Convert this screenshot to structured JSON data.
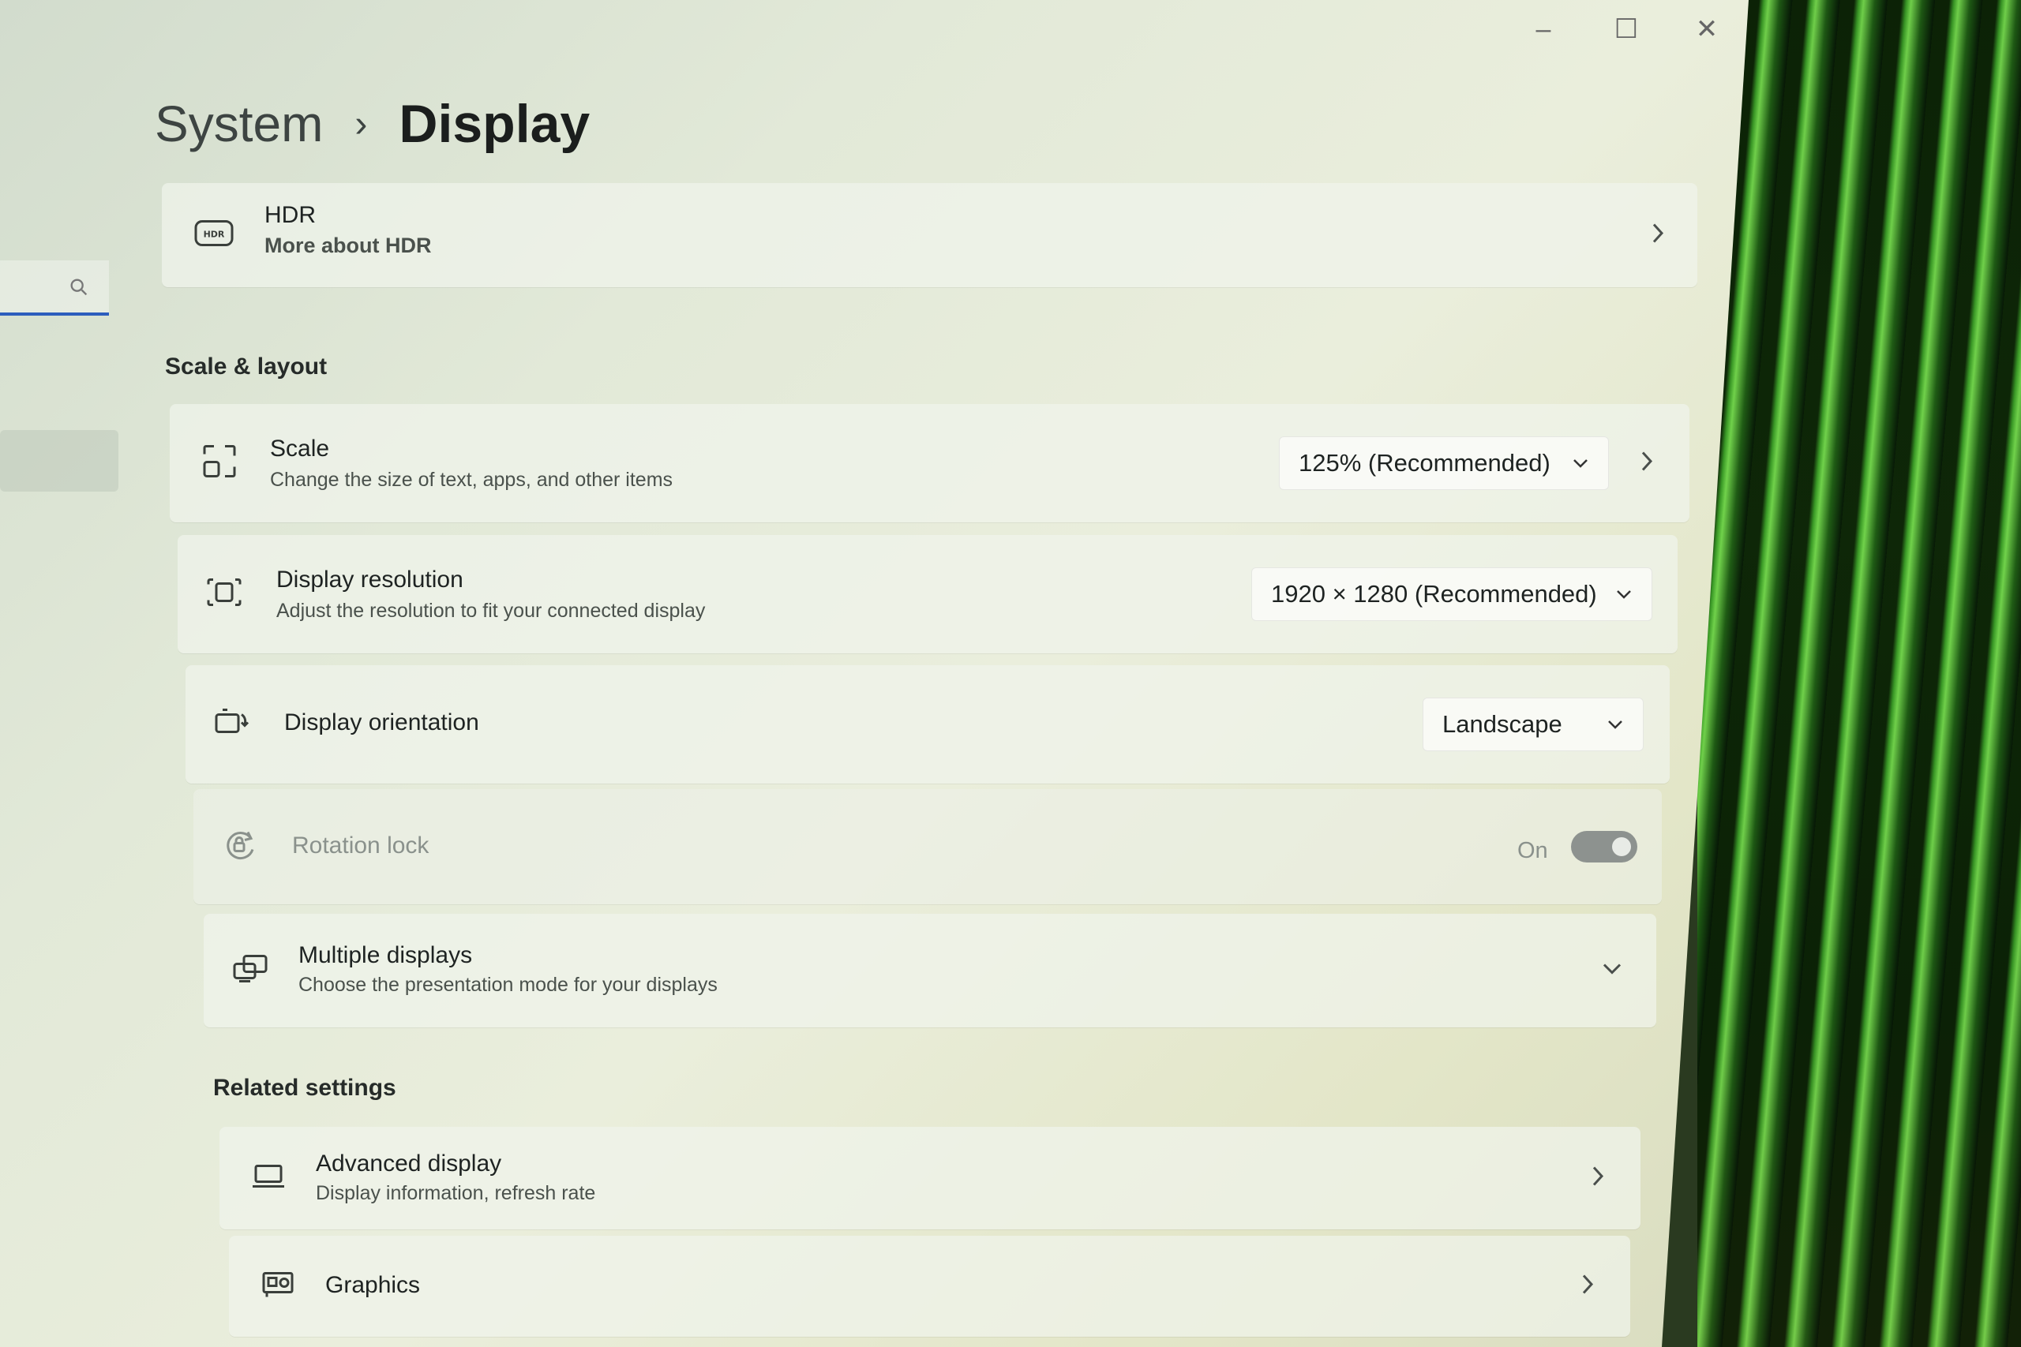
{
  "window": {
    "controls": {
      "minimize": "–",
      "maximize": "☐",
      "close": "✕"
    }
  },
  "breadcrumb": {
    "parent": "System",
    "separator": "›",
    "current": "Display"
  },
  "hdr": {
    "title": "HDR",
    "link": "More about HDR"
  },
  "scale_layout": {
    "heading": "Scale & layout",
    "scale": {
      "title": "Scale",
      "subtitle": "Change the size of text, apps, and other items",
      "value": "125% (Recommended)"
    },
    "resolution": {
      "title": "Display resolution",
      "subtitle": "Adjust the resolution to fit your connected display",
      "value": "1920 × 1280 (Recommended)"
    },
    "orientation": {
      "title": "Display orientation",
      "value": "Landscape"
    },
    "rotation_lock": {
      "title": "Rotation lock",
      "state": "On"
    },
    "multiple_displays": {
      "title": "Multiple displays",
      "subtitle": "Choose the presentation mode for your displays"
    }
  },
  "related": {
    "heading": "Related settings",
    "advanced_display": {
      "title": "Advanced display",
      "subtitle": "Display information, refresh rate"
    },
    "graphics": {
      "title": "Graphics"
    }
  },
  "colors": {
    "accent": "#2c5dbd",
    "link": "#1e4fb0"
  }
}
